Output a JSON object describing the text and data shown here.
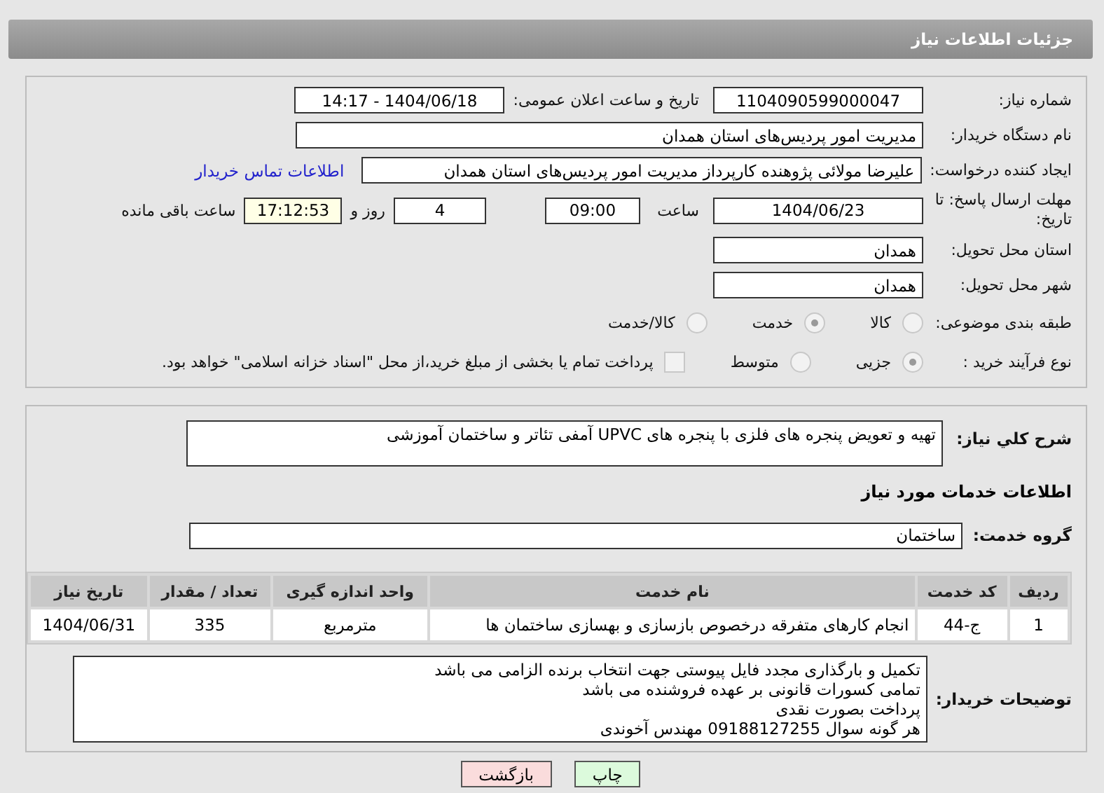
{
  "header": {
    "title": "جزئیات اطلاعات نیاز"
  },
  "need_number": {
    "label": "شماره نیاز:",
    "value": "1104090599000047"
  },
  "announce": {
    "label": "تاریخ و ساعت اعلان عمومی:",
    "value": "1404/06/18 - 14:17"
  },
  "buyer_org": {
    "label": "نام دستگاه خریدار:",
    "value": "مدیریت امور پردیس‌های استان همدان"
  },
  "requester": {
    "label": "ایجاد کننده درخواست:",
    "value": "علیرضا مولائی پژوهنده کارپرداز مدیریت امور پردیس‌های استان همدان",
    "link": "اطلاعات تماس خریدار"
  },
  "deadline": {
    "label": "مهلت ارسال پاسخ: تا تاریخ:",
    "date": "1404/06/23",
    "time_label": "ساعت",
    "time": "09:00",
    "days": "4",
    "days_label": "روز و",
    "remaining": "17:12:53",
    "remaining_label": "ساعت باقی مانده"
  },
  "province": {
    "label": "استان محل تحویل:",
    "value": "همدان"
  },
  "city": {
    "label": "شهر محل تحویل:",
    "value": "همدان"
  },
  "category": {
    "label": "طبقه بندی موضوعی:",
    "options": [
      {
        "label": "کالا",
        "selected": false
      },
      {
        "label": "خدمت",
        "selected": true
      },
      {
        "label": "کالا/خدمت",
        "selected": false
      }
    ]
  },
  "purchase_type": {
    "label": "نوع فرآیند خرید :",
    "options": [
      {
        "label": "جزیی",
        "selected": true
      },
      {
        "label": "متوسط",
        "selected": false
      }
    ],
    "treasury": {
      "checked": false,
      "label": "پرداخت تمام یا بخشی از مبلغ خرید،از محل \"اسناد خزانه اسلامی\" خواهد بود."
    }
  },
  "description": {
    "label": "شرح کلي نیاز:",
    "value": "تهیه و تعویض پنجره های فلزی با پنجره های UPVC آمفی تئاتر و ساختمان آموزشی"
  },
  "services_heading": "اطلاعات خدمات مورد نیاز",
  "service_group": {
    "label": "گروه خدمت:",
    "value": "ساختمان"
  },
  "table": {
    "columns": [
      "ردیف",
      "کد خدمت",
      "نام خدمت",
      "واحد اندازه گیری",
      "تعداد / مقدار",
      "تاریخ نیاز"
    ],
    "rows": [
      [
        "1",
        "ج-44",
        "انجام کارهای متفرقه درخصوص بازسازی و بهسازی ساختمان ها",
        "مترمربع",
        "335",
        "1404/06/31"
      ]
    ]
  },
  "buyer_notes": {
    "label": "توضیحات خریدار:",
    "lines": [
      "تکمیل و بارگذاری مجدد فایل پیوستی جهت انتخاب برنده الزامی می باشد",
      "تمامی کسورات قانونی بر عهده فروشنده می باشد",
      "پرداخت بصورت نقدی",
      "هر گونه سوال 09188127255 مهندس آخوندی"
    ]
  },
  "buttons": [
    {
      "kind": "print",
      "label": "چاپ"
    },
    {
      "kind": "back",
      "label": "بازگشت"
    }
  ]
}
